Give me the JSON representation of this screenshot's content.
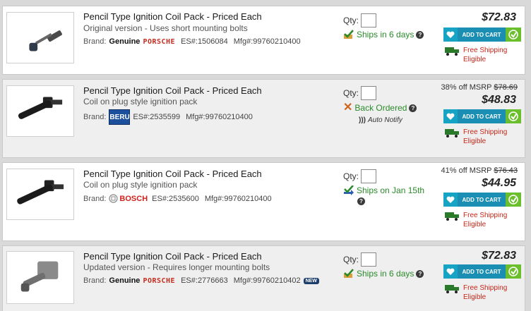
{
  "items": [
    {
      "title": "Pencil Type Ignition Coil Pack - Priced Each",
      "subtitle": "Original version - Uses short mounting bolts",
      "brand_label": "Brand:",
      "brand_genuine": "Genuine",
      "brand_name": "PORSCHE",
      "es_number": "ES#:1506084",
      "mfg_number": "Mfg#:99760210400",
      "qty_label": "Qty:",
      "status": "Ships in 6 days",
      "price": "$72.83",
      "add_to_cart": "ADD TO CART",
      "free_shipping": [
        "Free Shipping",
        "Eligible"
      ]
    },
    {
      "title": "Pencil Type Ignition Coil Pack - Priced Each",
      "subtitle": "Coil on plug style ignition pack",
      "brand_label": "Brand:",
      "brand_logo_text": "BERU",
      "es_number": "ES#:2535599",
      "mfg_number": "Mfg#:99760210400",
      "qty_label": "Qty:",
      "status": "Back Ordered",
      "auto_notify": "Auto Notify",
      "msrp_discount": "38% off MSRP",
      "msrp_price": "$78.69",
      "price": "$48.83",
      "add_to_cart": "ADD TO CART",
      "free_shipping": [
        "Free Shipping",
        "Eligible"
      ]
    },
    {
      "title": "Pencil Type Ignition Coil Pack - Priced Each",
      "subtitle": "Coil on plug style ignition pack",
      "brand_label": "Brand:",
      "brand_name": "BOSCH",
      "es_number": "ES#:2535600",
      "mfg_number": "Mfg#:99760210400",
      "qty_label": "Qty:",
      "status": "Ships on Jan 15th",
      "msrp_discount": "41% off MSRP",
      "msrp_price": "$76.43",
      "price": "$44.95",
      "add_to_cart": "ADD TO CART",
      "free_shipping": [
        "Free Shipping",
        "Eligible"
      ]
    },
    {
      "title": "Pencil Type Ignition Coil Pack - Priced Each",
      "subtitle": "Updated version - Requires longer mounting bolts",
      "brand_label": "Brand:",
      "brand_genuine": "Genuine",
      "brand_name": "PORSCHE",
      "es_number": "ES#:2776663",
      "mfg_number": "Mfg#:99760210402",
      "new_badge": "NEW",
      "qty_label": "Qty:",
      "status": "Ships in 6 days",
      "price": "$72.83",
      "add_to_cart": "ADD TO CART",
      "free_shipping": [
        "Free Shipping",
        "Eligible"
      ]
    }
  ],
  "colors": {
    "status_green": "#2a8a2a",
    "backorder_x": "#d0641a",
    "cart_blue": "#1a8fb3",
    "go_green": "#6cbf2c",
    "free_ship_red": "#c4271a"
  },
  "icons": {
    "status_ok": "check-truck-icon",
    "backorder": "x-icon",
    "help": "question-icon",
    "notify": "signal-icon",
    "wishlist": "heart-icon",
    "go": "arrow-icon",
    "shipping": "truck-icon"
  }
}
